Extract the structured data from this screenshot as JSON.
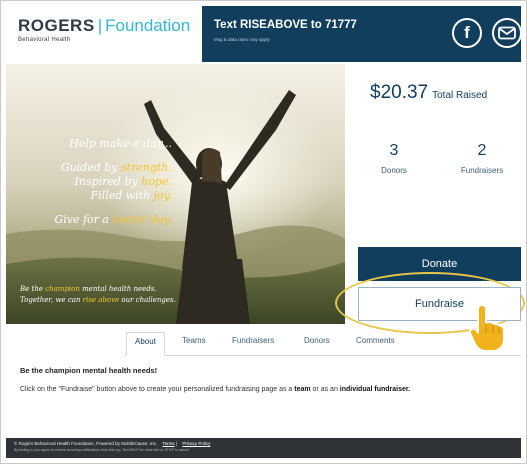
{
  "header": {
    "brand_name": "ROGERS",
    "brand_separator": "|",
    "brand_suffix": "Foundation",
    "brand_subtitle": "Behavioral Health",
    "text_cta": "Text RISEABOVE to 71777",
    "text_disclaimer": "Msg & data rates may apply",
    "social": {
      "facebook_glyph": "f",
      "facebook_icon": "facebook-icon",
      "email_icon": "email-icon"
    }
  },
  "hero": {
    "line1": "Help make a day...",
    "line2_pre": "Guided by ",
    "line2_hl": "strength.",
    "line3_pre": "Inspired by ",
    "line3_hl": "hope.",
    "line4_pre": "Filled with ",
    "line4_hl": "joy.",
    "line5_pre": "Give for a ",
    "line5_hl": "better day.",
    "bottom1_pre": "Be the ",
    "bottom1_hl": "champion",
    "bottom1_post": " mental health needs.",
    "bottom2_pre": "Together, we can ",
    "bottom2_hl": "rise above",
    "bottom2_post": " our challenges."
  },
  "stats": {
    "amount": "$20.37",
    "amount_label": "Total Raised",
    "donors_count": "3",
    "donors_label": "Donors",
    "fundraisers_count": "2",
    "fundraisers_label": "Fundraisers"
  },
  "actions": {
    "donate_label": "Donate",
    "fundraise_label": "Fundraise"
  },
  "tabs": [
    {
      "label": "About"
    },
    {
      "label": "Teams"
    },
    {
      "label": "Fundraisers"
    },
    {
      "label": "Donors"
    },
    {
      "label": "Comments"
    }
  ],
  "content": {
    "title": "Be the champion mental health needs!",
    "body_pre": "Click on the \"Fundraise\" button above to create your personalized fundraising page as a ",
    "body_team": "team",
    "body_mid": " or as an ",
    "body_individual": "individual fundraiser."
  },
  "footer": {
    "copyright": "© Rogers Behavioral Health Foundation, Powered by MobileCause, Inc.",
    "terms": "Terms",
    "divider": "|",
    "privacy": "Privacy Policy",
    "fineprint": "By texting in you agree to receive recurring notifications from this org. Text HELP for more info or STOP to cancel."
  },
  "colors": {
    "navy": "#123e5e",
    "accent_blue": "#35b6d6",
    "highlight_yellow": "#f2c534",
    "ring": "#e6c64a"
  }
}
